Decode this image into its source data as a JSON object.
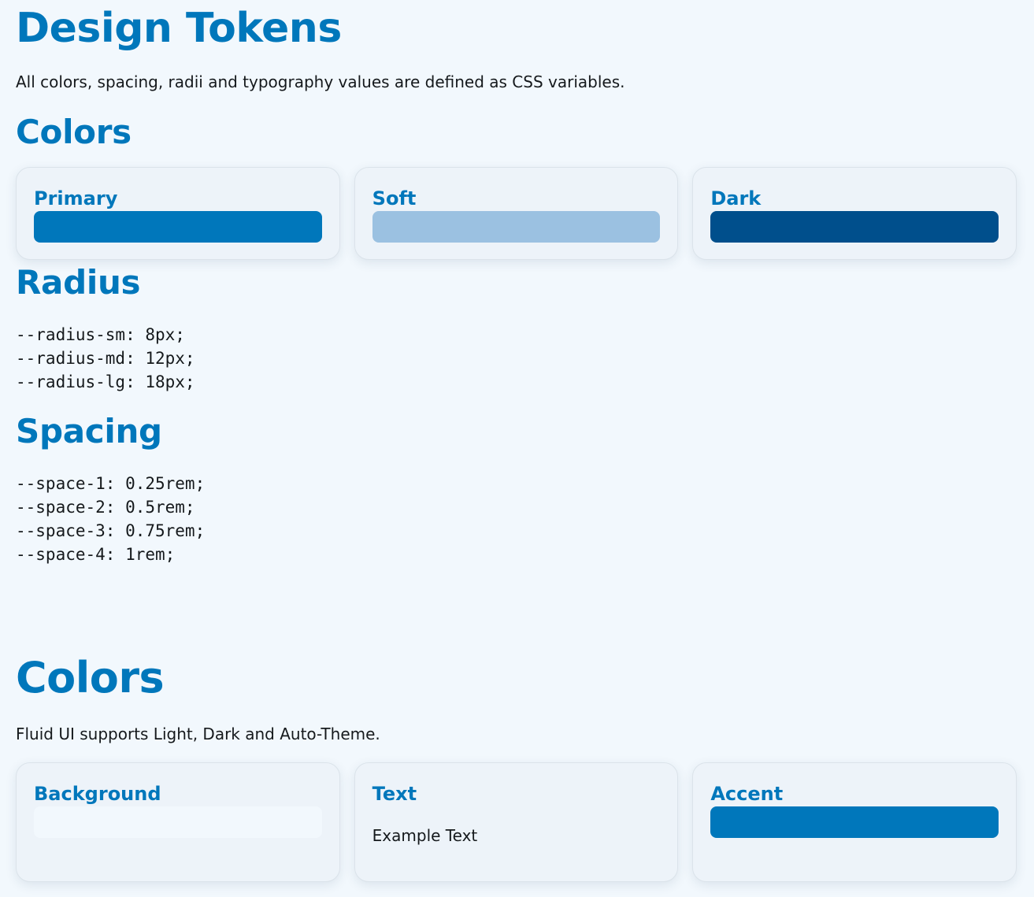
{
  "page": {
    "title": "Design Tokens",
    "intro": "All colors, spacing, radii and typography values are defined as CSS variables."
  },
  "colors_section": {
    "heading": "Colors",
    "swatches": [
      {
        "label": "Primary",
        "color": "#0077bb"
      },
      {
        "label": "Soft",
        "color": "#9bc1e1"
      },
      {
        "label": "Dark",
        "color": "#004f8c"
      }
    ]
  },
  "radius_section": {
    "heading": "Radius",
    "lines": [
      "--radius-sm: 8px;",
      "--radius-md: 12px;",
      "--radius-lg: 18px;"
    ]
  },
  "spacing_section": {
    "heading": "Spacing",
    "lines": [
      "--space-1: 0.25rem;",
      "--space-2: 0.5rem;",
      "--space-3: 0.75rem;",
      "--space-4: 1rem;"
    ]
  },
  "theme_section": {
    "heading": "Colors",
    "intro": "Fluid UI supports Light, Dark and Auto-Theme.",
    "cards": [
      {
        "label": "Background",
        "color": "#f2f8fd"
      },
      {
        "label": "Text",
        "example": "Example Text"
      },
      {
        "label": "Accent",
        "color": "#0077bb"
      }
    ]
  }
}
